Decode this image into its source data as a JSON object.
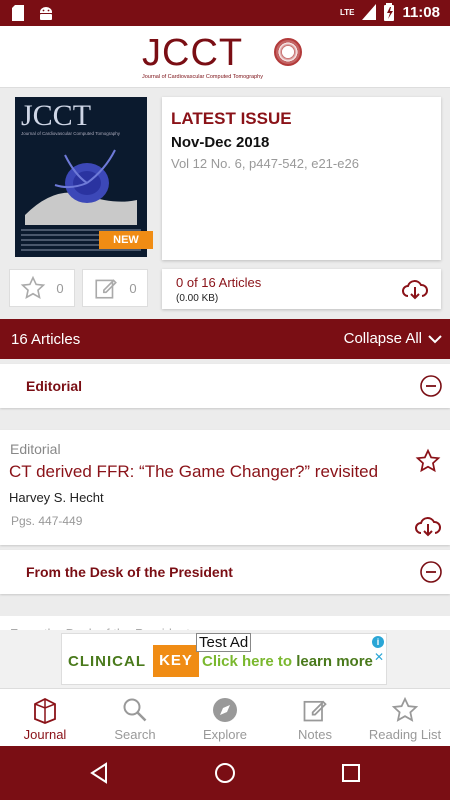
{
  "status_bar": {
    "network": "LTE",
    "time": "11:08"
  },
  "header": {
    "logo": "JCCT",
    "logo_subtitle": "Journal of Cardiovascular Computed Tomography"
  },
  "cover": {
    "title": "JCCT",
    "subtitle": "Journal of Cardiovascular Computed Tomography",
    "badge": "NEW"
  },
  "issue": {
    "label": "LATEST ISSUE",
    "date": "Nov-Dec 2018",
    "volume": "Vol 12 No. 6, p447-542, e21-e26"
  },
  "actions": {
    "favorites_count": "0",
    "notes_count": "0"
  },
  "download": {
    "articles": "0 of 16 Articles",
    "size": "(0.00 KB)"
  },
  "articles_bar": {
    "count": "16 Articles",
    "collapse": "Collapse All"
  },
  "sections": [
    {
      "title": "Editorial"
    },
    {
      "title": "From the Desk of the President"
    }
  ],
  "article": {
    "category": "Editorial",
    "title": "CT derived FFR: “The Game Changer?” revisited",
    "author": "Harvey S. Hecht",
    "pages": "Pgs. 447-449"
  },
  "partial_article": {
    "category": "From the Desk of the President"
  },
  "ad": {
    "label": "Test Ad",
    "brand_clinical": "CLINICAL",
    "brand_key": "KEY",
    "cta_prefix": "Click here to ",
    "cta_bold": "learn more"
  },
  "bottom_nav": [
    {
      "label": "Journal",
      "icon": "journal-icon",
      "active": true
    },
    {
      "label": "Search",
      "icon": "search-icon"
    },
    {
      "label": "Explore",
      "icon": "compass-icon"
    },
    {
      "label": "Notes",
      "icon": "notes-icon"
    },
    {
      "label": "Reading List",
      "icon": "star-icon"
    }
  ],
  "colors": {
    "brand": "#7a0e14",
    "accent": "#8a1218",
    "badge": "#f08c14"
  }
}
